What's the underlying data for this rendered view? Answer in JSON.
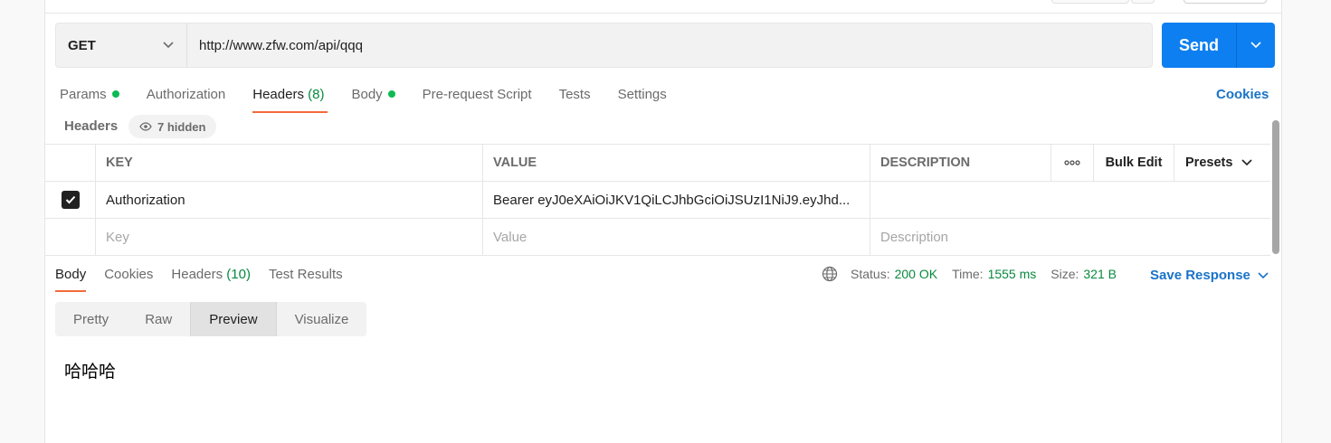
{
  "request": {
    "method": "GET",
    "url": "http://www.zfw.com/api/qqq",
    "send_label": "Send"
  },
  "request_tabs": [
    {
      "label": "Params",
      "dot": true
    },
    {
      "label": "Authorization"
    },
    {
      "label": "Headers",
      "count": "(8)",
      "active": true
    },
    {
      "label": "Body",
      "dot": true
    },
    {
      "label": "Pre-request Script"
    },
    {
      "label": "Tests"
    },
    {
      "label": "Settings"
    }
  ],
  "cookies_link": "Cookies",
  "headers_section": {
    "title": "Headers",
    "hidden_label": "7 hidden"
  },
  "table": {
    "columns": {
      "key": "KEY",
      "value": "VALUE",
      "description": "DESCRIPTION",
      "more": "ooo",
      "bulk_edit": "Bulk Edit",
      "presets": "Presets"
    },
    "rows": [
      {
        "checked": true,
        "key": "Authorization",
        "value": "Bearer eyJ0eXAiOiJKV1QiLCJhbGciOiJSUzI1NiJ9.eyJhd...",
        "description": ""
      }
    ],
    "placeholders": {
      "key": "Key",
      "value": "Value",
      "description": "Description"
    }
  },
  "response": {
    "tabs": [
      {
        "label": "Body",
        "active": true
      },
      {
        "label": "Cookies"
      },
      {
        "label": "Headers",
        "count": "(10)"
      },
      {
        "label": "Test Results"
      }
    ],
    "status_label": "Status:",
    "status_value": "200 OK",
    "time_label": "Time:",
    "time_value": "1555 ms",
    "size_label": "Size:",
    "size_value": "321 B",
    "save_label": "Save Response",
    "view_modes": [
      "Pretty",
      "Raw",
      "Preview",
      "Visualize"
    ],
    "active_view": "Preview",
    "body": "哈哈哈"
  },
  "colors": {
    "accent": "#0d7ff0",
    "active_tab": "#f26b3a",
    "success": "#078a3e",
    "dot": "#0cbb52"
  }
}
